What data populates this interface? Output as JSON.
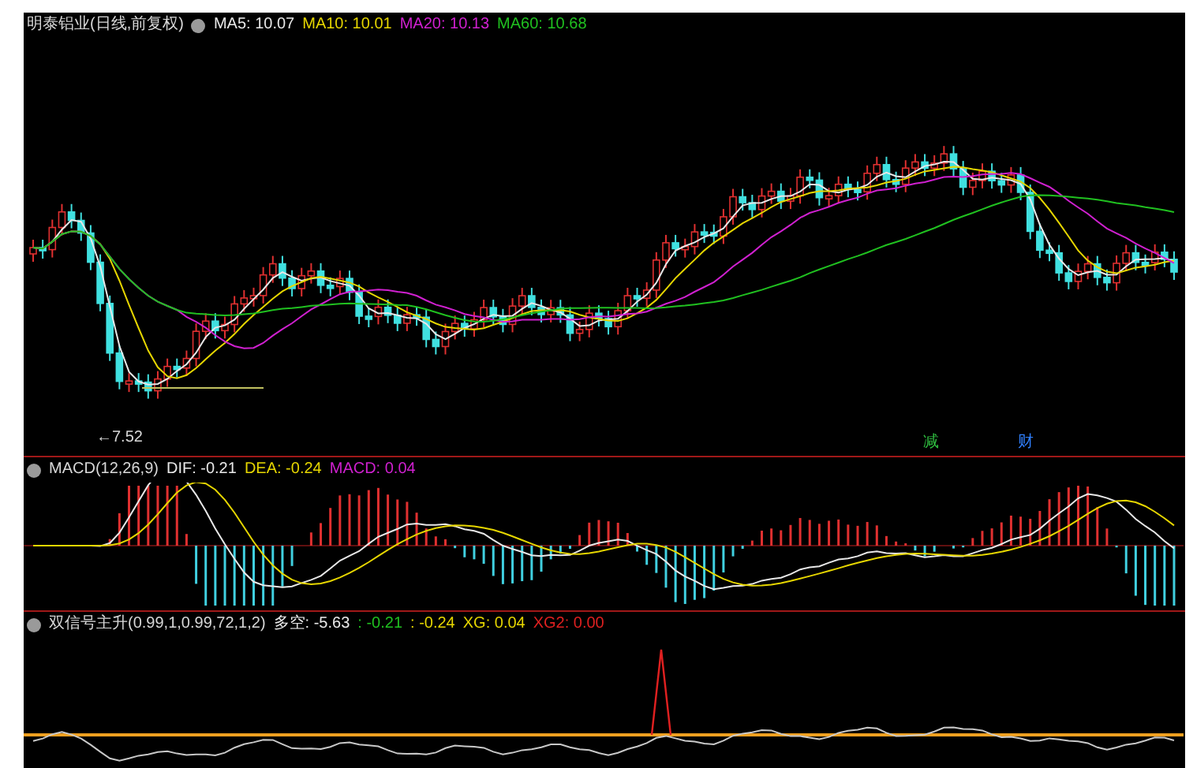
{
  "main_panel": {
    "title": "明泰铝业(日线,前复权)",
    "indicators": [
      {
        "label": "MA5: 10.07",
        "color": "#e8e8e8"
      },
      {
        "label": "MA10: 10.01",
        "color": "#e6d600"
      },
      {
        "label": "MA20: 10.13",
        "color": "#d020d0"
      },
      {
        "label": "MA60: 10.68",
        "color": "#20c020"
      }
    ],
    "low_marker": "←7.52",
    "event_markers": [
      {
        "label": "减",
        "color": "#30c040"
      },
      {
        "label": "财",
        "color": "#3080ff"
      }
    ]
  },
  "macd_panel": {
    "title": "MACD(12,26,9)",
    "values": [
      {
        "label": "DIF: -0.21",
        "color": "#e8e8e8"
      },
      {
        "label": "DEA: -0.24",
        "color": "#e6d600"
      },
      {
        "label": "MACD: 0.04",
        "color": "#d020d0"
      }
    ]
  },
  "signal_panel": {
    "title": "双信号主升(0.99,1,0.99,72,1,2)",
    "values": [
      {
        "label": "多空: -5.63",
        "color": "#e8e8e8"
      },
      {
        "label": ": -0.21",
        "color": "#20c020"
      },
      {
        "label": ": -0.24",
        "color": "#e6d600"
      },
      {
        "label": "XG: 0.04",
        "color": "#e6d600"
      },
      {
        "label": "XG2: 0.00",
        "color": "#e02020"
      }
    ]
  }
}
